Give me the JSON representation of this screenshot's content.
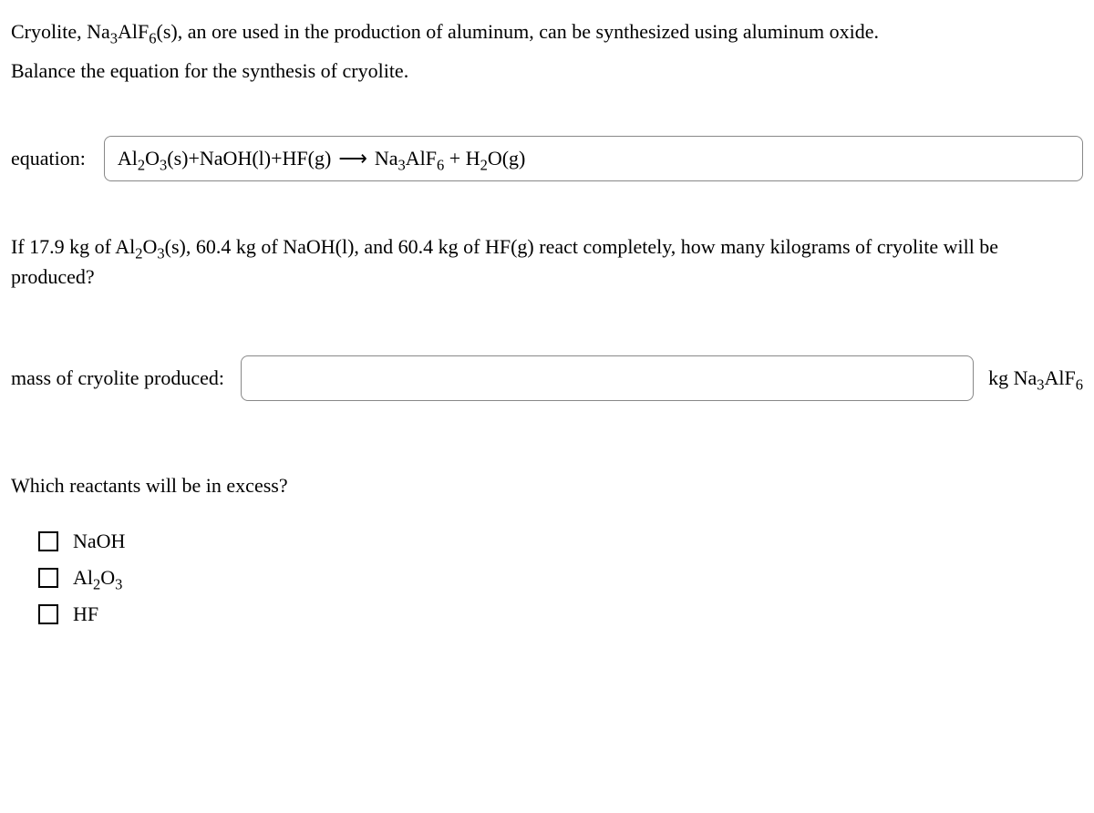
{
  "intro": {
    "prefix": "Cryolite, ",
    "compound_base1": "Na",
    "compound_sub1": "3",
    "compound_base2": "AlF",
    "compound_sub2": "6",
    "compound_state": "(s)",
    "suffix": ", an ore used in the production of aluminum, can be synthesized using aluminum oxide."
  },
  "instruction": "Balance the equation for the synthesis of cryolite.",
  "equation": {
    "label": "equation:",
    "lhs_al": "Al",
    "lhs_al_sub": "2",
    "lhs_o": "O",
    "lhs_o_sub": "3",
    "lhs_al2o3_state": "(s)",
    "plus": "+",
    "lhs_naoh": "NaOH(l)",
    "lhs_hf": "HF(g)",
    "arrow": "⟶",
    "rhs_na": "Na",
    "rhs_na_sub": "3",
    "rhs_alf": "AlF",
    "rhs_alf_sub": "6",
    "rhs_plus": " + ",
    "rhs_h": "H",
    "rhs_h_sub": "2",
    "rhs_o": "O(g)"
  },
  "question2": {
    "prefix": "If 17.9 kg of ",
    "al": "Al",
    "al_sub": "2",
    "o": "O",
    "o_sub": "3",
    "state": "(s)",
    "suffix": ", 60.4 kg of NaOH(l), and 60.4 kg of HF(g) react completely, how many kilograms of cryolite will be produced?"
  },
  "mass": {
    "label": "mass of cryolite produced:",
    "value": "",
    "unit_prefix": "kg ",
    "unit_na": "Na",
    "unit_na_sub": "3",
    "unit_alf": "AlF",
    "unit_alf_sub": "6"
  },
  "excess_question": "Which reactants will be in excess?",
  "options": {
    "opt1": "NaOH",
    "opt2_al": "Al",
    "opt2_al_sub": "2",
    "opt2_o": "O",
    "opt2_o_sub": "3",
    "opt3": "HF"
  }
}
